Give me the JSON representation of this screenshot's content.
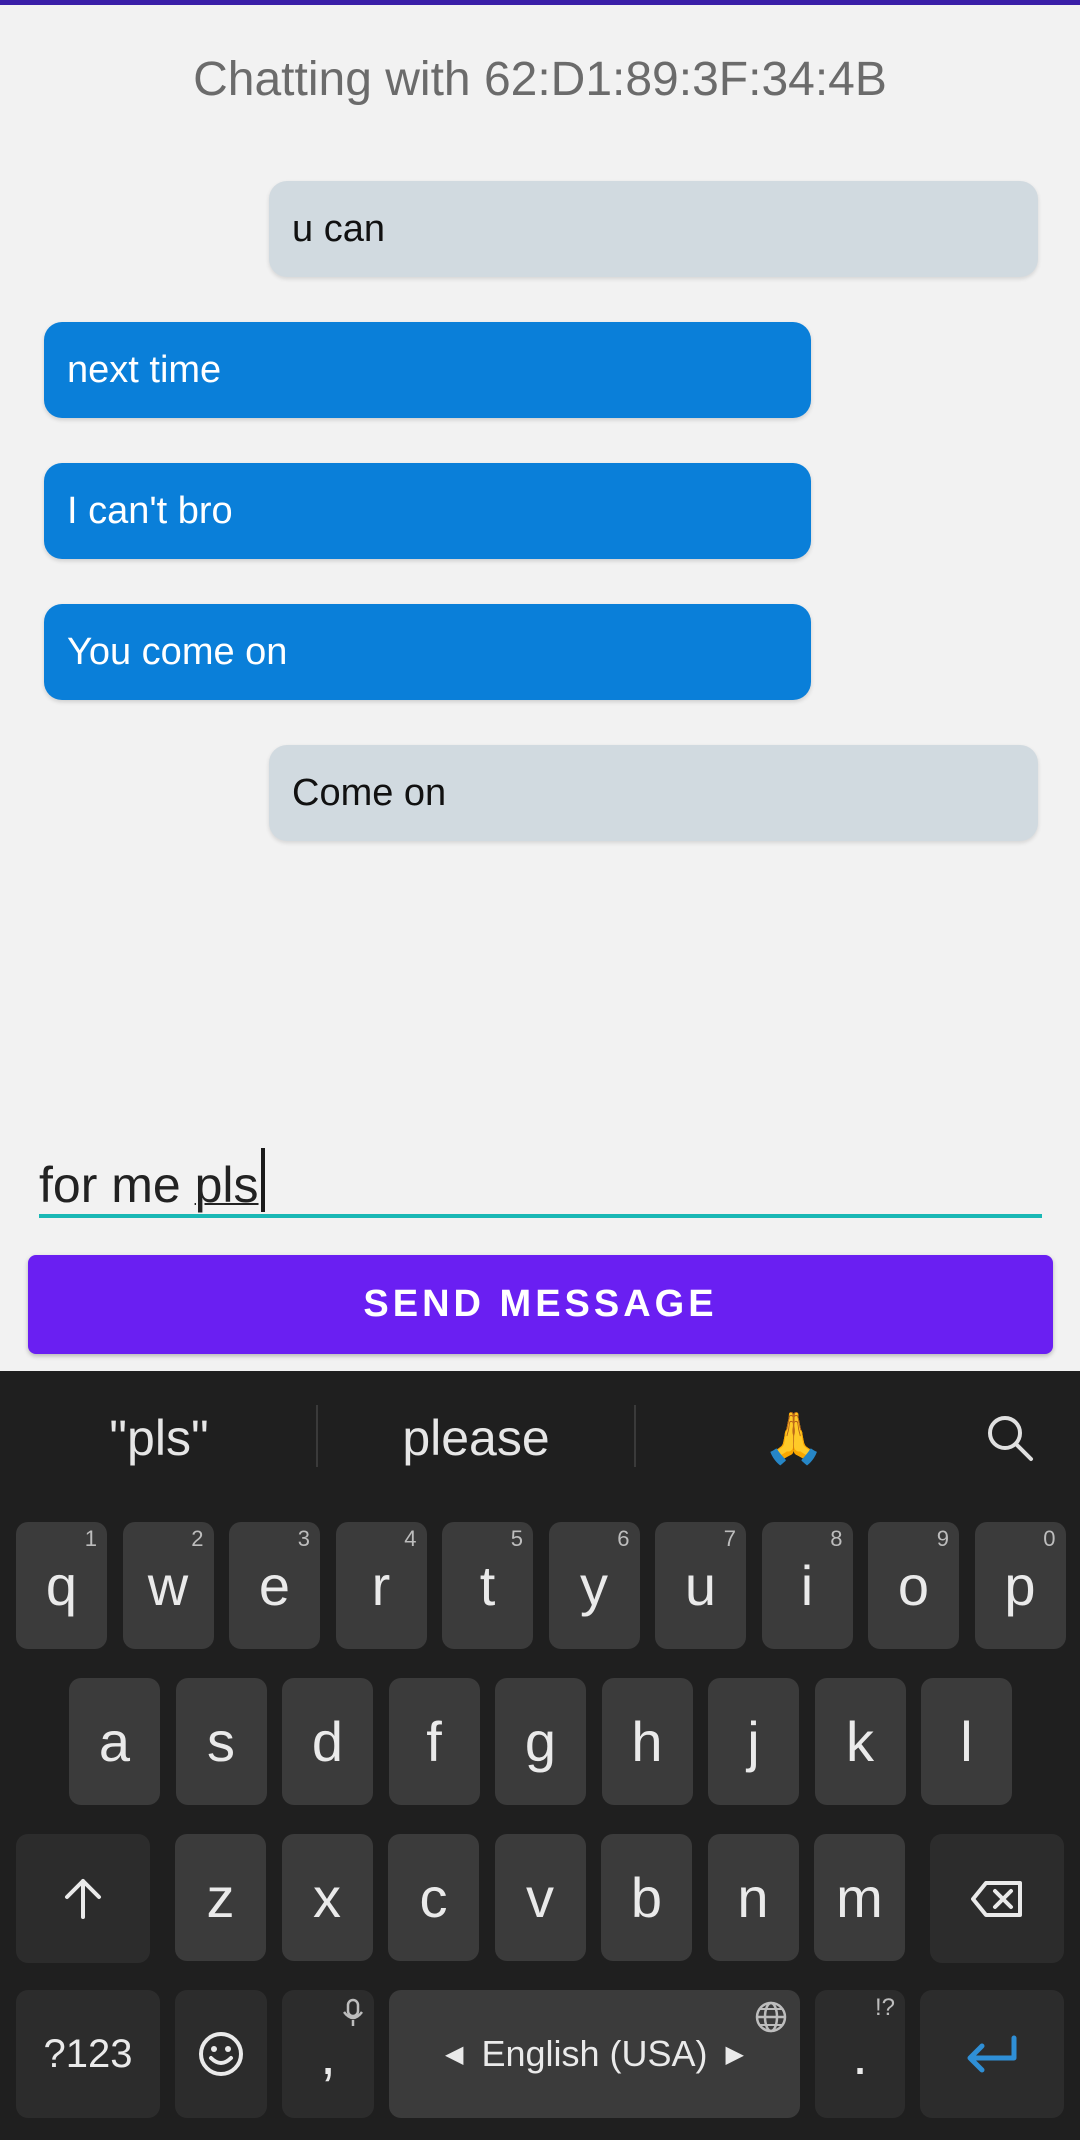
{
  "chat": {
    "title": "Chatting with 62:D1:89:3F:34:4B",
    "messages": [
      {
        "text": "u can",
        "side": "received"
      },
      {
        "text": "next time",
        "side": "sent"
      },
      {
        "text": "I can't bro",
        "side": "sent"
      },
      {
        "text": "You come on",
        "side": "sent"
      },
      {
        "text": "Come on",
        "side": "received"
      }
    ]
  },
  "composer": {
    "value_prefix": "for me ",
    "value_composing": "pls",
    "send_label": "SEND MESSAGE"
  },
  "keyboard": {
    "suggestions": [
      "\"pls\"",
      "please",
      "🙏"
    ],
    "row1": [
      {
        "key": "q",
        "hint": "1"
      },
      {
        "key": "w",
        "hint": "2"
      },
      {
        "key": "e",
        "hint": "3"
      },
      {
        "key": "r",
        "hint": "4"
      },
      {
        "key": "t",
        "hint": "5"
      },
      {
        "key": "y",
        "hint": "6"
      },
      {
        "key": "u",
        "hint": "7"
      },
      {
        "key": "i",
        "hint": "8"
      },
      {
        "key": "o",
        "hint": "9"
      },
      {
        "key": "p",
        "hint": "0"
      }
    ],
    "row2": [
      "a",
      "s",
      "d",
      "f",
      "g",
      "h",
      "j",
      "k",
      "l"
    ],
    "row3": [
      "z",
      "x",
      "c",
      "v",
      "b",
      "n",
      "m"
    ],
    "symbols_label": "?123",
    "comma": ",",
    "space_label": "English (USA)",
    "period": ".",
    "period_hint": "!?",
    "colors": {
      "accent": "#6a1ff2",
      "sent_bubble": "#0a7fd9",
      "received_bubble": "#d1dae0",
      "enter_icon": "#2f8fd6"
    }
  }
}
